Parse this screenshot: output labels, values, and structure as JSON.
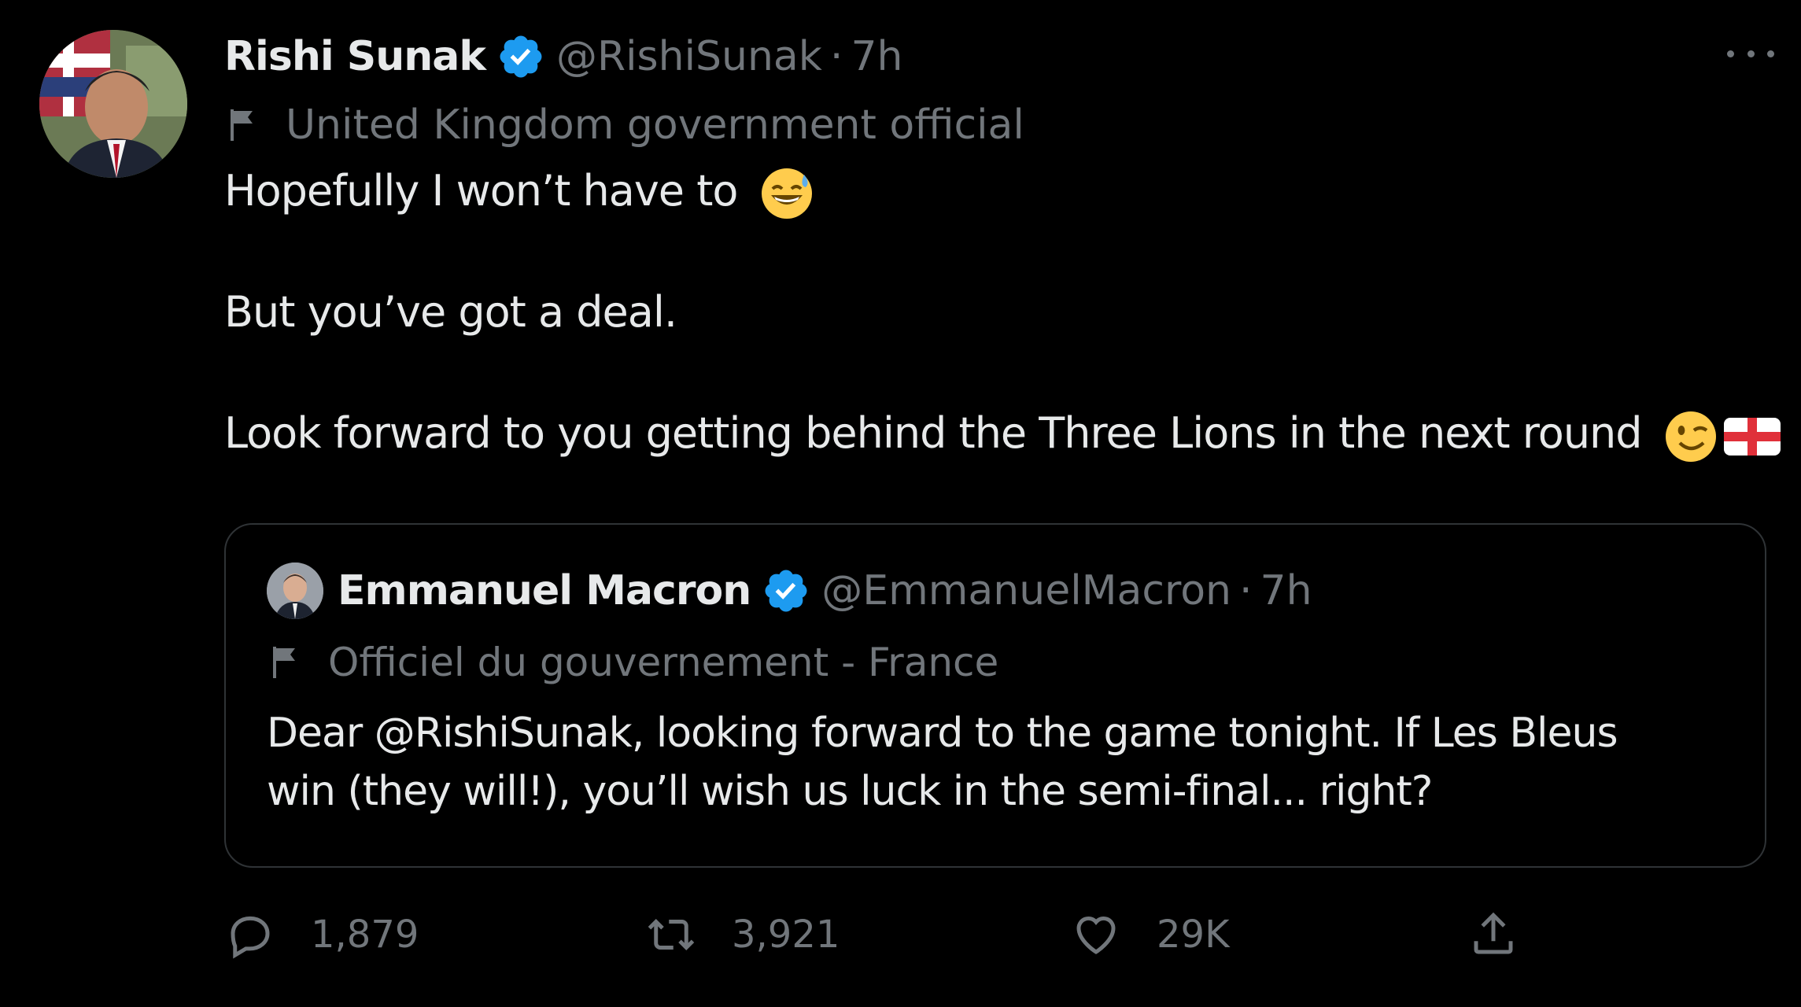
{
  "tweet": {
    "author_name": "Rishi Sunak",
    "author_handle": "@RishiSunak",
    "separator": "·",
    "time": "7h",
    "label": "United Kingdom government official",
    "lines": [
      "Hopefully I won’t have to",
      "But you’ve got a deal.",
      "Look forward to you getting behind the Three Lions in the next round"
    ]
  },
  "quoted_tweet": {
    "author_name": "Emmanuel Macron",
    "author_handle": "@EmmanuelMacron",
    "separator": "·",
    "time": "7h",
    "label": "Officiel du gouvernement - France",
    "lines": [
      "Dear @RishiSunak, looking forward to the game tonight. If Les Bleus",
      "win (they will!), you’ll wish us luck in the semi-final... right?"
    ]
  },
  "actions": {
    "replies": "1,879",
    "retweets": "3,921",
    "likes": "29K"
  },
  "icons": {
    "verified": "verified-badge-icon",
    "more": "more-icon",
    "label_flag": "flag-icon",
    "reply": "reply-icon",
    "retweet": "retweet-icon",
    "like": "heart-icon",
    "share": "share-icon"
  },
  "colors": {
    "background": "#000000",
    "primary_text": "#e7e9ea",
    "secondary_text": "#71767b",
    "verified_blue": "#1d9bf0",
    "border": "#2f3336"
  }
}
